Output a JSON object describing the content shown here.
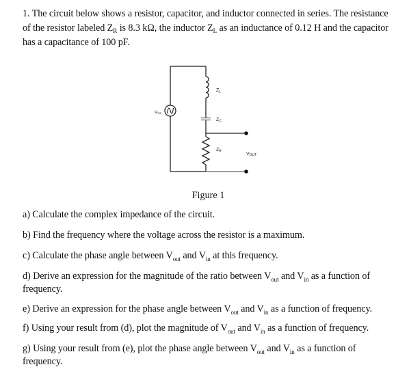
{
  "problem": {
    "number": "1.",
    "intro_line1": "The circuit below shows a resistor, capacitor, and inductor connected in series. The resistance",
    "intro_line2_a": "of the resistor labeled Z",
    "intro_line2_sub1": "R",
    "intro_line2_b": " is 8.3 kΩ, the inductor Z",
    "intro_line2_sub2": "L",
    "intro_line2_c": " as an inductance of 0.12 H and the capacitor",
    "intro_line3": "has a capacitance of 100 pF."
  },
  "circuit": {
    "source_label": "V",
    "source_sub": "IN",
    "inductor_label": "Z",
    "inductor_sub": "L",
    "capacitor_label": "Z",
    "capacitor_sub": "C",
    "resistor_label": "Z",
    "resistor_sub": "R",
    "output_label": "V",
    "output_sub": "OUT"
  },
  "figure_caption": "Figure 1",
  "questions": [
    {
      "id": "a",
      "parts": [
        "a) Calculate the complex impedance of the circuit."
      ]
    },
    {
      "id": "b",
      "parts": [
        "b) Find the frequency where the voltage across the resistor is a maximum."
      ]
    },
    {
      "id": "c",
      "text_a": "c) Calculate the phase angle between V",
      "sub1": "out",
      "text_b": " and V",
      "sub2": "in",
      "text_c": " at this frequency."
    },
    {
      "id": "d",
      "text_a": "d) Derive an expression for the magnitude of the ratio between V",
      "sub1": "out",
      "text_b": " and V",
      "sub2": "in",
      "text_c": " as a function of",
      "line2": "frequency."
    },
    {
      "id": "e",
      "text_a": "e) Derive an expression for the phase angle between V",
      "sub1": "out",
      "text_b": " and V",
      "sub2": "in",
      "text_c": " as a function of frequency."
    },
    {
      "id": "f",
      "text_a": "f) Using your result from (d), plot the magnitude of V",
      "sub1": "out",
      "text_b": " and V",
      "sub2": "in",
      "text_c": " as a function of frequency."
    },
    {
      "id": "g",
      "text_a": "g) Using your result from (e), plot the phase angle between V",
      "sub1": "out",
      "text_b": " and V",
      "sub2": "in",
      "text_c": " as a function of",
      "line2": "frequency."
    }
  ]
}
